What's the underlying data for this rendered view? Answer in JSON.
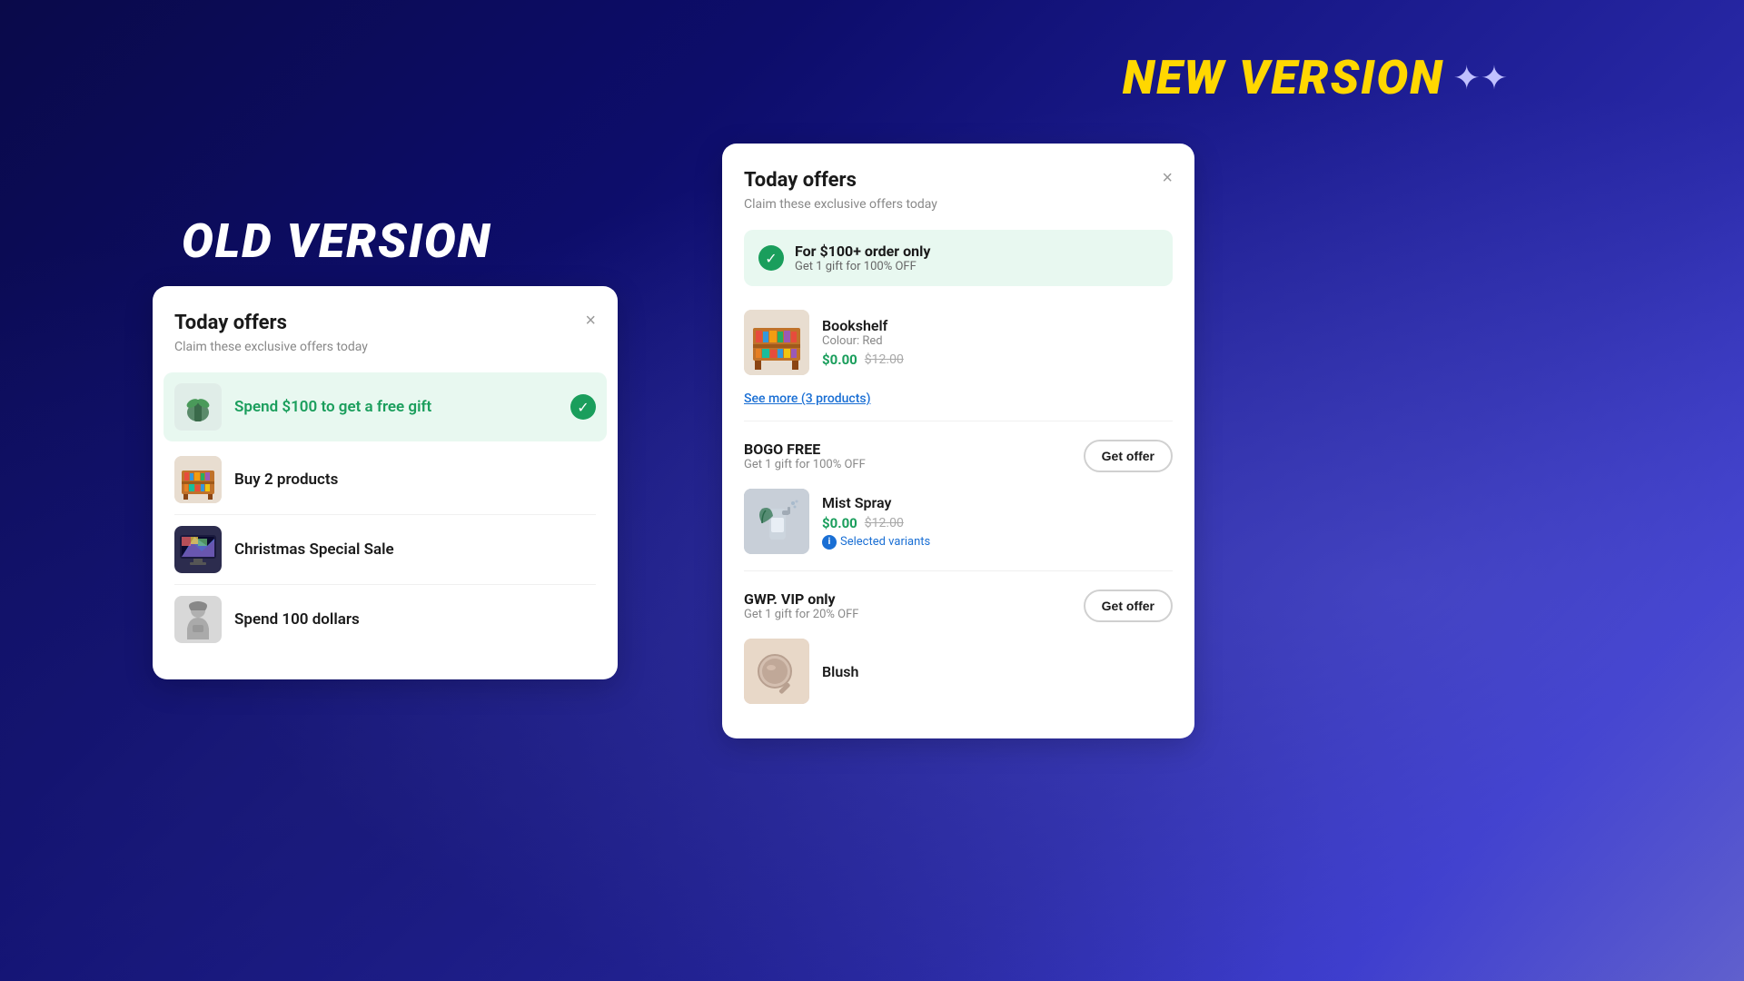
{
  "new_version_label": "NEW VERSION",
  "old_version_label": "OLD VERSION",
  "sparkle": "✦",
  "old_card": {
    "title": "Today offers",
    "subtitle": "Claim these exclusive offers today",
    "close_label": "×",
    "items": [
      {
        "label": "Spend $100 to get a free gift",
        "active": true,
        "thumb_type": "gift"
      },
      {
        "label": "Buy 2 products",
        "active": false,
        "thumb_type": "bookshelf"
      },
      {
        "label": "Christmas Special Sale",
        "active": false,
        "thumb_type": "computer"
      },
      {
        "label": "Spend 100 dollars",
        "active": false,
        "thumb_type": "person"
      }
    ]
  },
  "new_card": {
    "title": "Today offers",
    "subtitle": "Claim these exclusive offers today",
    "close_label": "×",
    "banner": {
      "title": "For $100+ order only",
      "desc": "Get 1 gift for 100% OFF"
    },
    "product": {
      "name": "Bookshelf",
      "variant": "Colour: Red",
      "price_current": "$0.00",
      "price_original": "$12.00"
    },
    "see_more_label": "See more (3 products)",
    "bogo": {
      "title": "BOGO FREE",
      "desc": "Get 1 gift for 100% OFF",
      "btn": "Get offer"
    },
    "bogo_product": {
      "name": "Mist Spray",
      "price_current": "$0.00",
      "price_original": "$12.00",
      "selected_variants": "Selected variants"
    },
    "gwp": {
      "title": "GWP. VIP only",
      "desc": "Get 1 gift for 20% OFF",
      "btn": "Get offer"
    },
    "gwp_product": {
      "name": "Blush"
    }
  }
}
